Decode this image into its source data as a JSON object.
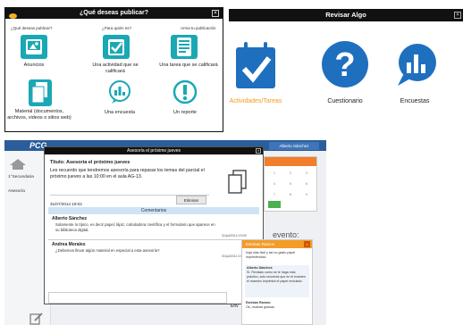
{
  "panel1": {
    "title": "¿Qué deseas publicar?",
    "close": "×",
    "q1": "¿Qué deseas publicar?",
    "q2": "¿Para quién es?",
    "q3": "Arma tu publicación",
    "options": [
      {
        "label": "Anuncios"
      },
      {
        "label": "Una actividad que se calificará"
      },
      {
        "label": "Una tarea que se calificará"
      },
      {
        "label": "Material (documentos, archivos, videos o sitios web)"
      },
      {
        "label": "Una encuesta"
      },
      {
        "label": "Un reporte"
      }
    ]
  },
  "panel2": {
    "title": "Revisar Algo",
    "close": "×",
    "items": [
      {
        "label": "Actividades/Tareas",
        "color": "#f59a23"
      },
      {
        "label": "Cuestionario",
        "color": "#222"
      },
      {
        "label": "Encuestas",
        "color": "#222"
      }
    ]
  },
  "app": {
    "logo": "PCG",
    "user": "Alberto Sánchez",
    "side1": "1°Secundaria",
    "side2": "Asesoría",
    "calendar_days": [
      "1",
      "2",
      "3",
      "4",
      "5",
      "6",
      "7",
      "8",
      "9"
    ],
    "evento": "evento:"
  },
  "modal": {
    "title": "Asesoría el próximo jueves",
    "close": "×",
    "post_title": "Titulo: Asesoria el próximo jueves",
    "post_body": "Les recuerdo que tendremos asesoría para repasar los temas del parcial el próximo jueves a las 10:00 en el aula AG-13.",
    "date": "31/07/2014 19:02",
    "delete": "Eliminar",
    "comments_header": "Comentarios",
    "comments": [
      {
        "name": "Alberto Sánchez",
        "text": "Solamente lo típico, es decir papel, lápiz, calculadora científica y el formulario que aparece en su biblioteca digital.",
        "date": "31/jul/2014 19:09"
      },
      {
        "name": "Andrea Morales",
        "text": "¿Debemos llevar algún material en especial a esta asesoría?",
        "date": "31/jul/2014 19:03"
      }
    ],
    "send": "Env"
  },
  "chat": {
    "title": "Esteban Ramos",
    "close": "×",
    "messages": [
      {
        "text": "hoja más fácil y así no gasto papel imprimiéndolo."
      },
      {
        "name": "Alberto Sánchez:",
        "text": "Sí. Revisalo como se te haga más práctico, solo recuerda que en el examen el maestro imprimirá el papel reciclado."
      },
      {
        "name": "Esteban Ramos:",
        "text": "Ok, muchas gracias."
      }
    ]
  }
}
